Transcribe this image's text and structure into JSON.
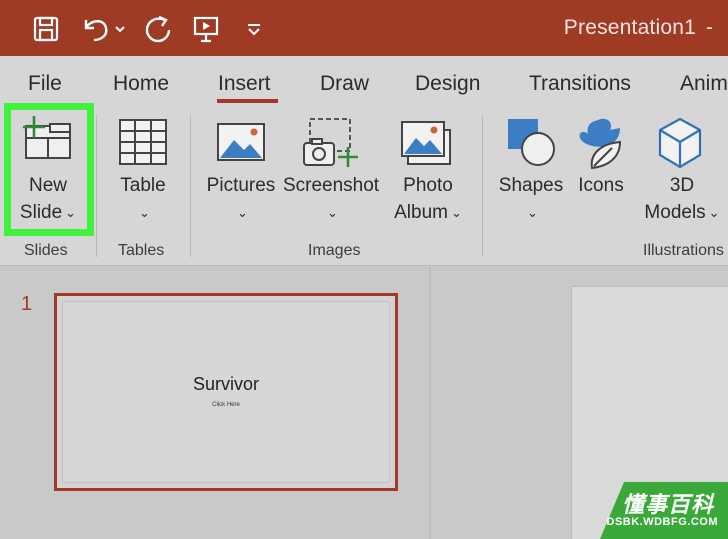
{
  "window": {
    "title": "Presentation1",
    "title_tail": " -"
  },
  "quick_access": {
    "save_icon": "save-icon",
    "undo_icon": "undo-icon",
    "redo_icon": "redo-icon",
    "present_icon": "present-from-start-icon",
    "customize_icon": "customize-toolbar-icon"
  },
  "tabs": [
    {
      "label": "File"
    },
    {
      "label": "Home"
    },
    {
      "label": "Insert",
      "active": true
    },
    {
      "label": "Draw"
    },
    {
      "label": "Design"
    },
    {
      "label": "Transitions"
    },
    {
      "label": "Anim"
    }
  ],
  "ribbon": {
    "slides": {
      "new_slide_line1": "New",
      "new_slide_line2": "Slide",
      "group_label": "Slides"
    },
    "tables": {
      "table_label": "Table",
      "group_label": "Tables"
    },
    "images": {
      "pictures_label": "Pictures",
      "screenshot_label": "Screenshot",
      "photo_album_line1": "Photo",
      "photo_album_line2": "Album",
      "group_label": "Images"
    },
    "illustrations": {
      "shapes_label": "Shapes",
      "icons_label": "Icons",
      "models_line1": "3D",
      "models_line2": "Models",
      "group_label": "Illustrations"
    }
  },
  "thumbnails": [
    {
      "number": "1",
      "title": "Survivor",
      "subtitle": "Click Here"
    }
  ],
  "watermark": {
    "cn": "懂事百科",
    "url": "DSBK.WDBFG.COM"
  },
  "colors": {
    "accent": "#9f3a25",
    "highlight": "#3ef23e",
    "ribbon_bg": "#d6d6d6"
  }
}
